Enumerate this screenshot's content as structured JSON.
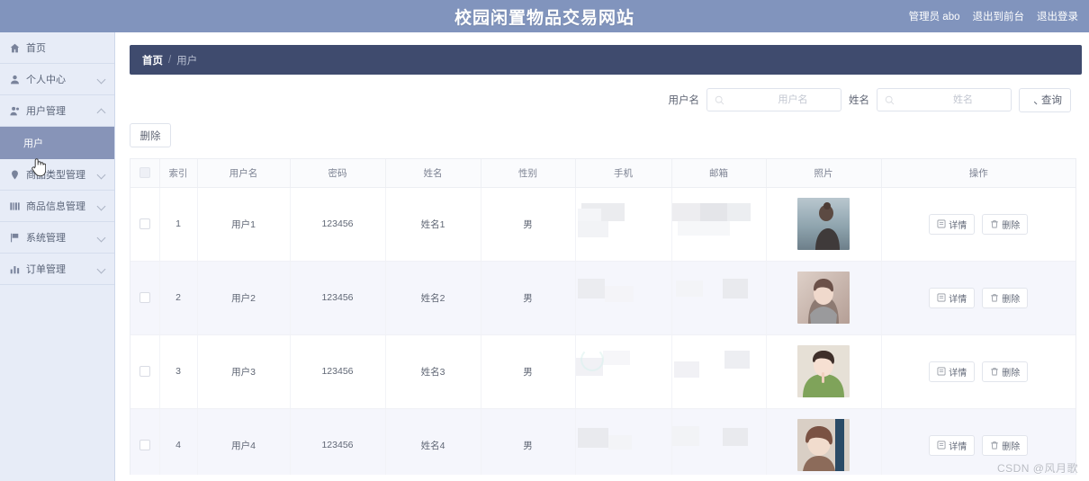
{
  "header": {
    "title": "校园闲置物品交易网站",
    "admin_label": "管理员 abo",
    "exit_front_label": "退出到前台",
    "logout_label": "退出登录",
    "bg_color": "#8194bd"
  },
  "sidebar": {
    "items": [
      {
        "label": "首页",
        "icon": "home-icon",
        "arrow": "none",
        "active": false,
        "sub": false
      },
      {
        "label": "个人中心",
        "icon": "user-icon",
        "arrow": "down",
        "active": false,
        "sub": false
      },
      {
        "label": "用户管理",
        "icon": "users-icon",
        "arrow": "up",
        "active": false,
        "sub": false
      },
      {
        "label": "用户",
        "icon": "none",
        "arrow": "none",
        "active": true,
        "sub": true
      },
      {
        "label": "商品类型管理",
        "icon": "pin-icon",
        "arrow": "down",
        "active": false,
        "sub": false
      },
      {
        "label": "商品信息管理",
        "icon": "grid-icon",
        "arrow": "down",
        "active": false,
        "sub": false
      },
      {
        "label": "系统管理",
        "icon": "flag-icon",
        "arrow": "down",
        "active": false,
        "sub": false
      },
      {
        "label": "订单管理",
        "icon": "bar-chart-icon",
        "arrow": "down",
        "active": false,
        "sub": false
      }
    ],
    "active_bg": "#8794b8"
  },
  "breadcrumb": {
    "root": "首页",
    "separator": "/",
    "current": "用户",
    "bg_color": "#3f4b6e"
  },
  "filter": {
    "username_label": "用户名",
    "username_placeholder": "用户名",
    "username_value": "",
    "name_label": "姓名",
    "name_placeholder": "姓名",
    "name_value": "",
    "query_label": "查询"
  },
  "toolbar": {
    "delete_label": "删除"
  },
  "table": {
    "columns": [
      "索引",
      "用户名",
      "密码",
      "姓名",
      "性别",
      "手机",
      "邮箱",
      "照片",
      "操作"
    ],
    "rows": [
      {
        "index": "1",
        "username": "用户1",
        "password": "123456",
        "name": "姓名1",
        "gender": "男",
        "phone": "",
        "email": "",
        "photo": "portrait-1"
      },
      {
        "index": "2",
        "username": "用户2",
        "password": "123456",
        "name": "姓名2",
        "gender": "男",
        "phone": "",
        "email": "",
        "photo": "portrait-2"
      },
      {
        "index": "3",
        "username": "用户3",
        "password": "123456",
        "name": "姓名3",
        "gender": "男",
        "phone": "",
        "email": "",
        "photo": "portrait-3"
      },
      {
        "index": "4",
        "username": "用户4",
        "password": "123456",
        "name": "姓名4",
        "gender": "男",
        "phone": "",
        "email": "",
        "photo": "portrait-4"
      }
    ],
    "row_actions": {
      "detail_label": "详情",
      "delete_label": "删除"
    }
  },
  "watermark": "CSDN @风月歌"
}
